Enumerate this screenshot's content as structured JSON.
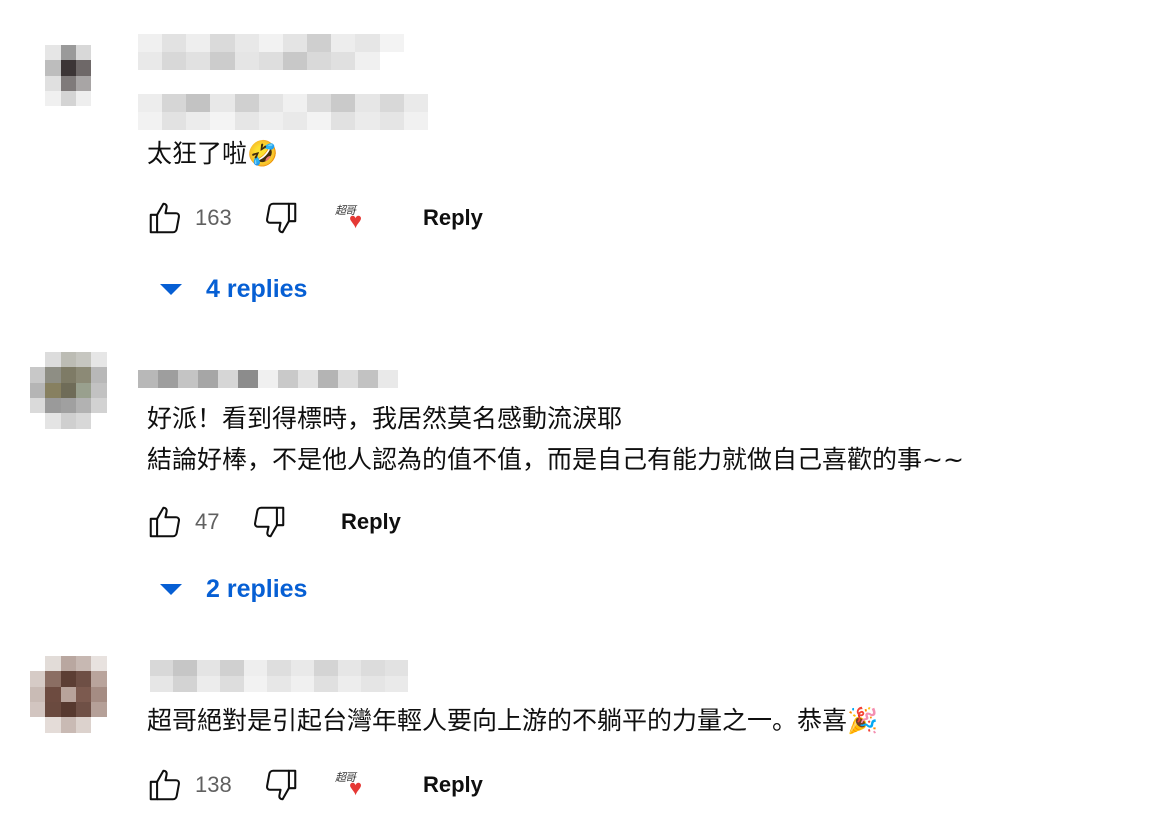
{
  "comments": [
    {
      "text_lines": [
        "太狂了啦🤣"
      ],
      "likes": "163",
      "reply_label": "Reply",
      "creator_heart": true,
      "replies_label": "4 replies"
    },
    {
      "text_lines": [
        "好派！看到得標時，我居然莫名感動流淚耶",
        "結論好棒，不是他人認為的值不值，而是自己有能力就做自己喜歡的事~~"
      ],
      "likes": "47",
      "reply_label": "Reply",
      "creator_heart": false,
      "replies_label": "2 replies"
    },
    {
      "text_lines": [
        "超哥絕對是引起台灣年輕人要向上游的不躺平的力量之一。恭喜🎉"
      ],
      "likes": "138",
      "reply_label": "Reply",
      "creator_heart": true
    }
  ],
  "icons": {
    "like": "thumbs-up-icon",
    "dislike": "thumbs-down-icon",
    "creator_heart": "creator-heart-icon",
    "expand": "caret-down-icon"
  },
  "colors": {
    "link": "#065fd4",
    "count": "#606060",
    "heart": "#e53935"
  }
}
